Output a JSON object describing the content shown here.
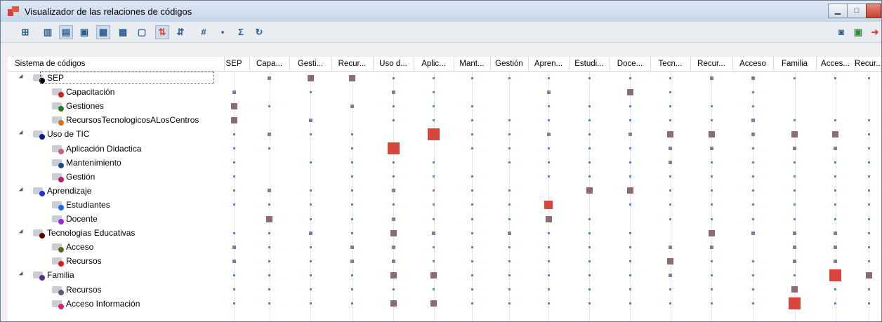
{
  "window": {
    "title": "Visualizador de las relaciones de códigos"
  },
  "toolbar": {
    "icons": [
      "grid-icon",
      "layout1-icon",
      "layout2-icon",
      "layout3-icon",
      "square-icon",
      "square2-icon",
      "number-icon",
      "sort-icon",
      "sort2-icon",
      "hash-icon",
      "tiles-icon",
      "sigma-icon",
      "refresh-icon",
      "camera-icon",
      "excel-icon",
      "export-icon"
    ]
  },
  "table": {
    "corner_label": "Sistema de códigos",
    "columns": [
      "SEP",
      "Capa...",
      "Gesti...",
      "Recur...",
      "Uso d...",
      "Aplic...",
      "Mant...",
      "Gestión",
      "Apren...",
      "Estudi...",
      "Doce...",
      "Tecn...",
      "Recur...",
      "Acceso",
      "Familia",
      "Acces...",
      "Recur..."
    ],
    "rows": [
      {
        "label": "SEP",
        "level": 0,
        "color": "#000000"
      },
      {
        "label": "Capacitación",
        "level": 1,
        "color": "#c0281f"
      },
      {
        "label": "Gestiones",
        "level": 1,
        "color": "#2a7a2a"
      },
      {
        "label": "RecursosTecnologicosALosCentros",
        "level": 1,
        "color": "#d3711d"
      },
      {
        "label": "Uso de TIC",
        "level": 0,
        "color": "#0b1a8c"
      },
      {
        "label": "Aplicación Didactica",
        "level": 1,
        "color": "#cc5c8c"
      },
      {
        "label": "Mantenimiento",
        "level": 1,
        "color": "#1a4d8c"
      },
      {
        "label": "Gestión",
        "level": 1,
        "color": "#b61c6c"
      },
      {
        "label": "Aprendizaje",
        "level": 0,
        "color": "#1a2ee0"
      },
      {
        "label": "Estudiantes",
        "level": 1,
        "color": "#1a6ee0"
      },
      {
        "label": "Docente",
        "level": 1,
        "color": "#9a28d8"
      },
      {
        "label": "Tecnologias Educativas",
        "level": 0,
        "color": "#5a0000"
      },
      {
        "label": "Acceso",
        "level": 1,
        "color": "#5a6a1a"
      },
      {
        "label": "Recursos",
        "level": 1,
        "color": "#e01a1a"
      },
      {
        "label": "Familia",
        "level": 0,
        "color": "#5a2a8c"
      },
      {
        "label": "Recursos",
        "level": 1,
        "color": "#5a5a7a"
      },
      {
        "label": "Acceso Información",
        "level": 1,
        "color": "#e0207a"
      }
    ],
    "cells": [
      [
        0,
        2,
        3,
        3,
        1,
        1,
        1,
        1,
        1,
        1,
        1,
        1,
        2,
        2,
        1,
        1,
        1
      ],
      [
        2,
        0,
        1,
        0,
        2,
        1,
        0,
        0,
        2,
        0,
        3,
        1,
        0,
        1,
        0,
        0,
        0
      ],
      [
        3,
        1,
        0,
        2,
        1,
        1,
        1,
        0,
        1,
        1,
        1,
        1,
        1,
        1,
        0,
        0,
        0
      ],
      [
        3,
        0,
        2,
        0,
        1,
        1,
        1,
        1,
        1,
        1,
        1,
        1,
        1,
        2,
        1,
        1,
        1
      ],
      [
        1,
        2,
        1,
        1,
        0,
        5,
        1,
        1,
        2,
        1,
        2,
        3,
        3,
        2,
        3,
        3,
        1
      ],
      [
        1,
        1,
        0,
        1,
        5,
        0,
        1,
        1,
        1,
        1,
        1,
        2,
        2,
        1,
        2,
        2,
        1
      ],
      [
        1,
        0,
        1,
        1,
        1,
        1,
        0,
        1,
        1,
        1,
        1,
        2,
        1,
        1,
        1,
        1,
        1
      ],
      [
        1,
        0,
        0,
        1,
        1,
        1,
        1,
        0,
        1,
        1,
        1,
        1,
        1,
        1,
        1,
        1,
        1
      ],
      [
        1,
        2,
        1,
        1,
        2,
        1,
        1,
        1,
        0,
        3,
        3,
        1,
        1,
        1,
        1,
        1,
        1
      ],
      [
        1,
        1,
        1,
        1,
        1,
        1,
        1,
        1,
        4,
        0,
        1,
        1,
        1,
        1,
        1,
        1,
        1
      ],
      [
        0,
        3,
        1,
        1,
        2,
        1,
        1,
        1,
        3,
        1,
        0,
        1,
        1,
        1,
        1,
        1,
        1
      ],
      [
        1,
        1,
        2,
        1,
        3,
        2,
        1,
        2,
        1,
        1,
        1,
        0,
        3,
        2,
        2,
        2,
        1
      ],
      [
        2,
        1,
        1,
        2,
        2,
        1,
        1,
        1,
        1,
        1,
        1,
        2,
        2,
        0,
        2,
        2,
        1
      ],
      [
        2,
        1,
        1,
        2,
        2,
        1,
        1,
        1,
        1,
        1,
        1,
        3,
        1,
        1,
        2,
        2,
        1
      ],
      [
        1,
        1,
        1,
        1,
        3,
        3,
        1,
        1,
        1,
        1,
        1,
        2,
        1,
        1,
        1,
        5,
        3
      ],
      [
        1,
        1,
        1,
        1,
        1,
        1,
        1,
        1,
        1,
        1,
        1,
        1,
        1,
        1,
        3,
        1,
        1
      ],
      [
        1,
        1,
        1,
        1,
        3,
        3,
        1,
        1,
        1,
        1,
        1,
        1,
        1,
        1,
        5,
        1,
        1
      ]
    ]
  },
  "colors": {
    "dot_small": "#5a86c0",
    "dot_medium": "#8b6a7a",
    "dot_large": "#d9453a"
  }
}
